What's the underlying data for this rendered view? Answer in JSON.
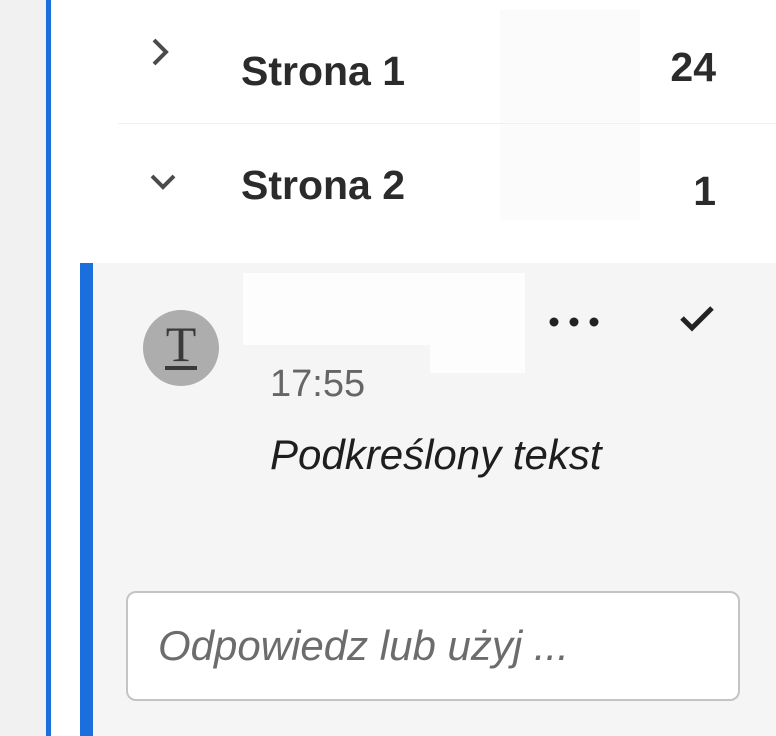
{
  "pages": [
    {
      "label": "Strona 1",
      "count": "24",
      "expanded": false,
      "chevron_icon": "chevron-right-icon"
    },
    {
      "label": "Strona 2",
      "count": "1",
      "expanded": true,
      "chevron_icon": "chevron-down-icon"
    }
  ],
  "comment": {
    "avatar_icon": "text-underline-icon",
    "avatar_glyph": "T",
    "time": "17:55",
    "text": "Podkreślony tekst",
    "more_icon": "more-horizontal-icon",
    "resolve_icon": "checkmark-icon"
  },
  "reply": {
    "placeholder": "Odpowiedz lub użyj ..."
  },
  "colors": {
    "accent": "#1a6fdc",
    "card_bg": "#f5f5f5",
    "avatar_bg": "#adadad"
  }
}
